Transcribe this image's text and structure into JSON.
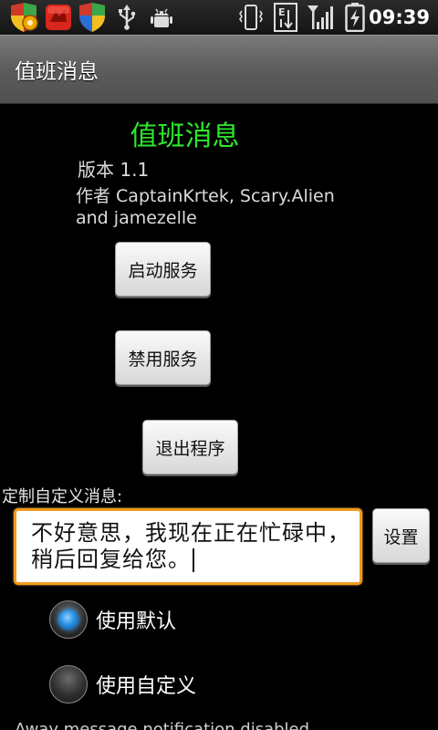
{
  "status_bar": {
    "time": "09:39",
    "icons": [
      "gear-shield-icon",
      "red-app-icon",
      "shield-icon",
      "usb-icon",
      "android-debug-icon",
      "vibrate-icon",
      "data-transfer-icon",
      "signal-icon",
      "battery-charging-icon"
    ]
  },
  "title_bar": {
    "title": "值班消息"
  },
  "app": {
    "name": "值班消息",
    "version": "版本 1.1",
    "authors": "作者 CaptainKrtek, Scary.Alien and jamezelle"
  },
  "buttons": {
    "start": "启动服务",
    "disable": "禁用服务",
    "exit": "退出程序",
    "set": "设置"
  },
  "custom_message": {
    "label": "定制自定义消息:",
    "value": "不好意思，我现在正在忙碌中，稍后回复给您。"
  },
  "options": [
    {
      "label": "使用默认",
      "checked": true
    },
    {
      "label": "使用自定义",
      "checked": false
    }
  ],
  "footer": "Away message notification disabled",
  "colors": {
    "accent_green": "#2ee82e",
    "focus_orange": "#f39a1e",
    "radio_blue": "#2a8fe0"
  }
}
